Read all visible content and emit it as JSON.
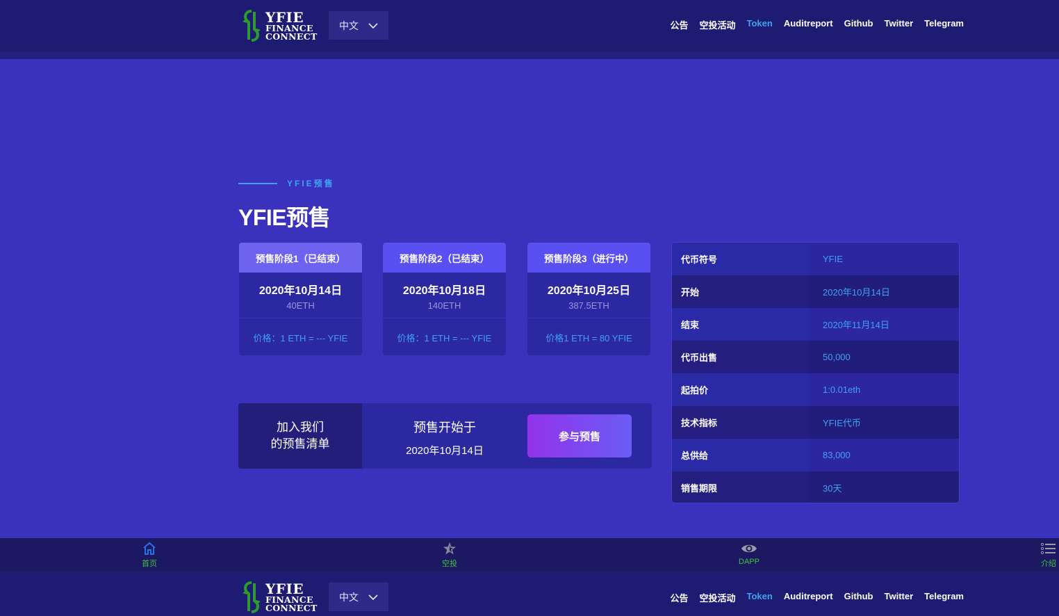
{
  "header": {
    "logo": {
      "line1": "YFIE",
      "line2": "FINANCE",
      "line3": "CONNECT"
    },
    "language": "中文",
    "nav": [
      {
        "label": "公告",
        "active": false
      },
      {
        "label": "空投活动",
        "active": false
      },
      {
        "label": "Token",
        "active": true
      },
      {
        "label": "Auditreport",
        "active": false
      },
      {
        "label": "Github",
        "active": false
      },
      {
        "label": "Twitter",
        "active": false
      },
      {
        "label": "Telegram",
        "active": false
      }
    ]
  },
  "section": {
    "eyebrow": "YFIE预售",
    "title": "YFIE预售"
  },
  "stages": [
    {
      "title": "预售阶段1（已结束）",
      "date": "2020年10月14日",
      "amount": "40ETH",
      "price": "价格：1 ETH = --- YFIE",
      "head_color": "#6e62f0"
    },
    {
      "title": "预售阶段2（已结束）",
      "date": "2020年10月18日",
      "amount": "140ETH",
      "price": "价格：1 ETH = --- YFIE",
      "head_color": "#5a4ff0"
    },
    {
      "title": "预售阶段3（进行中）",
      "date": "2020年10月25日",
      "amount": "387.5ETH",
      "price": "价格1 ETH = 80 YFIE",
      "head_color": "#5a4ff0"
    }
  ],
  "cta": {
    "join_line1": "加入我们",
    "join_line2": "的预售清单",
    "start_label": "预售开始于",
    "start_date": "2020年10月14日",
    "button": "参与预售"
  },
  "info": [
    {
      "key": "代币符号",
      "value": "YFIE"
    },
    {
      "key": "开始",
      "value": "2020年10月14日"
    },
    {
      "key": "结束",
      "value": "2020年11月14日"
    },
    {
      "key": "代币出售",
      "value": "50,000"
    },
    {
      "key": "起拍价",
      "value": "1:0.01eth"
    },
    {
      "key": "技术指标",
      "value": "YFIE代币"
    },
    {
      "key": "总供给",
      "value": "83,000"
    },
    {
      "key": "销售期限",
      "value": "30天"
    }
  ],
  "tabbar": [
    {
      "label": "首页",
      "icon": "home-icon"
    },
    {
      "label": "空投",
      "icon": "star-icon"
    },
    {
      "label": "DAPP",
      "icon": "eye-icon"
    },
    {
      "label": "介绍",
      "icon": "list-icon"
    }
  ],
  "colors": {
    "accent": "#3fa2f0",
    "background": "#3a32bd",
    "header": "#1e1b72",
    "tab_label": "#3bc43b"
  }
}
